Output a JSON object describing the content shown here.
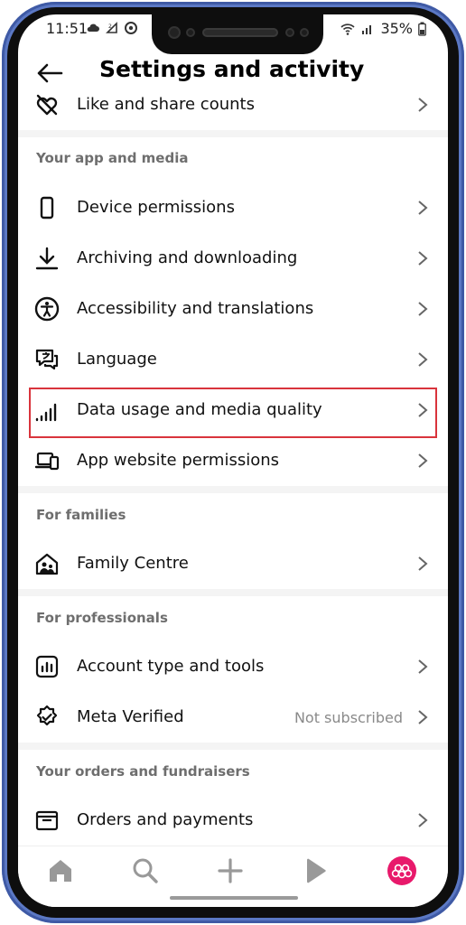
{
  "status_bar": {
    "time": "11:51",
    "battery": "35%"
  },
  "header": {
    "title": "Settings and activity"
  },
  "top_item": {
    "label": "Like and share counts"
  },
  "sections": {
    "app_media": {
      "heading": "Your app and media",
      "items": [
        {
          "label": "Device permissions",
          "icon": "phone-icon"
        },
        {
          "label": "Archiving and downloading",
          "icon": "download-icon"
        },
        {
          "label": "Accessibility and translations",
          "icon": "accessibility-icon"
        },
        {
          "label": "Language",
          "icon": "language-icon"
        },
        {
          "label": "Data usage and media quality",
          "icon": "signal-bars-icon"
        },
        {
          "label": "App website permissions",
          "icon": "devices-icon"
        }
      ]
    },
    "families": {
      "heading": "For families",
      "items": [
        {
          "label": "Family Centre",
          "icon": "family-home-icon"
        }
      ]
    },
    "professionals": {
      "heading": "For professionals",
      "items": [
        {
          "label": "Account type and tools",
          "icon": "bar-chart-icon"
        },
        {
          "label": "Meta Verified",
          "icon": "verified-badge-icon",
          "status": "Not subscribed"
        }
      ]
    },
    "orders": {
      "heading": "Your orders and fundraisers",
      "items": [
        {
          "label": "Orders and payments",
          "icon": "orders-box-icon"
        }
      ]
    }
  },
  "bottom_nav": [
    "home-icon",
    "search-icon",
    "plus-icon",
    "reels-play-icon",
    "profile-avatar"
  ],
  "colors": {
    "highlight": "#d9343c",
    "avatar": "#e8196b",
    "section_heading": "#6e6e6e",
    "phone_frame": "#5b78c4"
  }
}
